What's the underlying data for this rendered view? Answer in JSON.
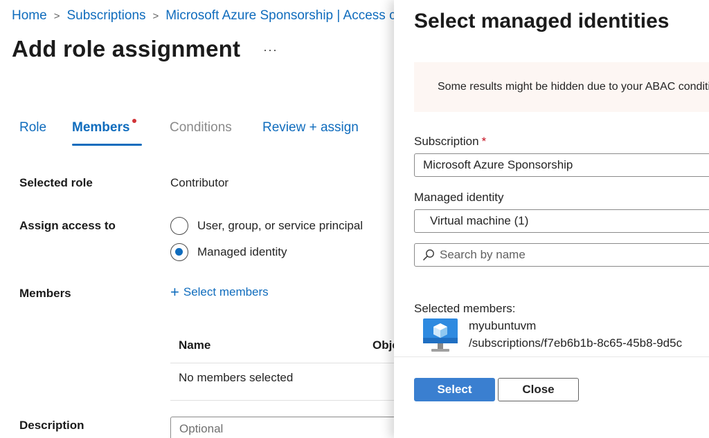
{
  "breadcrumb": [
    {
      "label": "Home"
    },
    {
      "label": "Subscriptions"
    },
    {
      "label": "Microsoft Azure Sponsorship | Access control (IAM)"
    }
  ],
  "page": {
    "title": "Add role assignment",
    "more": "···"
  },
  "tabs": [
    {
      "label": "Role"
    },
    {
      "label": "Members"
    },
    {
      "label": "Conditions"
    },
    {
      "label": "Review + assign"
    }
  ],
  "form": {
    "selected_role_label": "Selected role",
    "selected_role_value": "Contributor",
    "assign_access_label": "Assign access to",
    "option_user": "User, group, or service principal",
    "option_managed": "Managed identity",
    "members_label": "Members",
    "select_members": "Select members",
    "table": {
      "col_name": "Name",
      "col_object": "Object ID",
      "empty": "No members selected"
    },
    "description_label": "Description",
    "description_placeholder": "Optional"
  },
  "panel": {
    "title": "Select managed identities",
    "warning": "Some results might be hidden due to your ABAC conditions",
    "subscription_label": "Subscription",
    "required_mark": "*",
    "subscription_value": "Microsoft Azure Sponsorship",
    "managed_identity_label": "Managed identity",
    "managed_identity_value": "Virtual machine (1)",
    "search_placeholder": "Search by name",
    "selected_label": "Selected members:",
    "member": {
      "name": "myubuntuvm",
      "path": "/subscriptions/f7eb6b1b-8c65-45b8-9d5c"
    },
    "select_button": "Select",
    "close_button": "Close"
  },
  "colors": {
    "link": "#0f6cbd",
    "primary_button": "#3a7fd0",
    "warning_bg": "#fdf6f3",
    "warning_icon": "#c4661f",
    "required": "#c50f1f"
  }
}
